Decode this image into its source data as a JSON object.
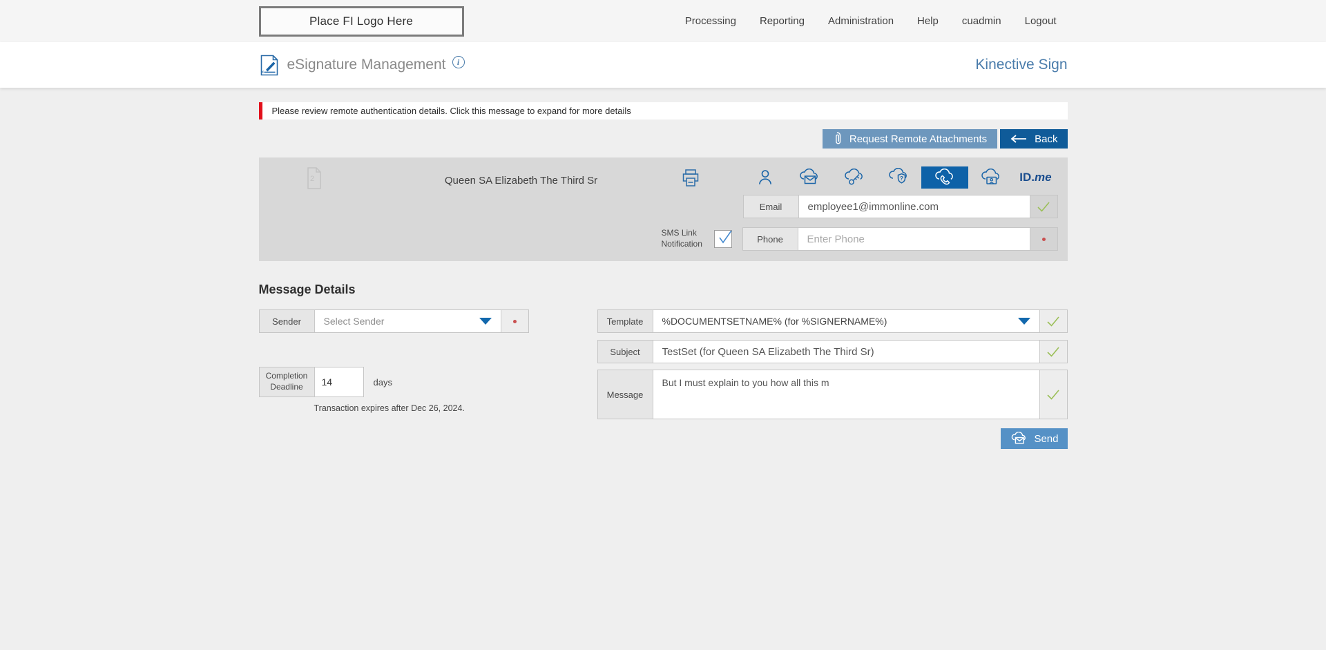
{
  "topbar": {
    "logo_text": "Place FI Logo Here",
    "nav": [
      "Processing",
      "Reporting",
      "Administration",
      "Help",
      "cuadmin",
      "Logout"
    ]
  },
  "header": {
    "title": "eSignature Management",
    "info_glyph": "i",
    "brand": "Kinective Sign"
  },
  "alert": {
    "text": "Please review remote authentication details. Click this message to expand for more details"
  },
  "actions": {
    "request_attachments_label": "Request Remote Attachments",
    "back_label": "Back"
  },
  "signer": {
    "name": "Queen SA Elizabeth The Third Sr",
    "document_count": "2",
    "auth_options": {
      "icons": [
        "person",
        "cloud-email",
        "cloud-key",
        "cloud-security-question",
        "cloud-phone",
        "cloud-id-card",
        "id-me"
      ],
      "selected": "cloud-phone"
    },
    "idme": {
      "bold": "ID.",
      "italic": "me"
    },
    "email_field": {
      "label": "Email",
      "value": "employee1@immonline.com",
      "status": "valid"
    },
    "sms_notification": {
      "label_line1": "SMS Link",
      "label_line2": "Notification",
      "checked": true
    },
    "phone_field": {
      "label": "Phone",
      "placeholder": "Enter Phone",
      "status": "required"
    }
  },
  "message_details": {
    "heading": "Message Details",
    "sender_field": {
      "label": "Sender",
      "placeholder": "Select Sender",
      "status": "required"
    },
    "completion": {
      "label_line1": "Completion",
      "label_line2": "Deadline",
      "value": "14",
      "unit": "days",
      "expires_note": "Transaction expires after Dec 26, 2024."
    },
    "template_field": {
      "label": "Template",
      "value": "%DOCUMENTSETNAME% (for %SIGNERNAME%)",
      "status": "valid"
    },
    "subject_field": {
      "label": "Subject",
      "value": "TestSet (for Queen SA Elizabeth The Third Sr)",
      "status": "valid"
    },
    "message_field": {
      "label": "Message",
      "value": "But I must explain to you how all this m",
      "status": "valid"
    },
    "send_label": "Send"
  },
  "colors": {
    "accent_blue": "#1b65a8",
    "selected_blue": "#0e62a8",
    "back_blue": "#0f5b99",
    "request_blue": "#6d97bd",
    "send_blue": "#5591c6",
    "valid_green": "#9bbf58",
    "alert_red": "#e2111c",
    "brand_blue": "#4a7cab",
    "panel_gray": "#d8d8d8",
    "page_gray": "#efefef"
  }
}
